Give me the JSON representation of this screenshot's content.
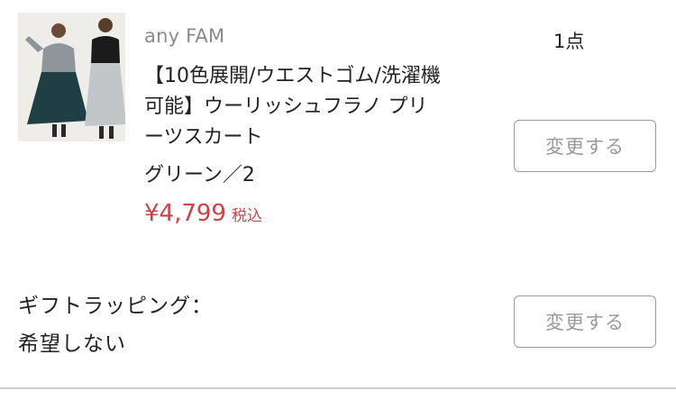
{
  "item": {
    "image_alt": "product-photo",
    "brand": "any FAM",
    "name": "【10色展開/ウエストゴム/洗濯機可能】ウーリッシュフラノ プリーツスカート",
    "variant": "グリーン／2",
    "price": "¥4,799",
    "tax_label": "税込",
    "quantity": "1点",
    "change_label": "変更する"
  },
  "gift": {
    "label": "ギフトラッピング：",
    "value": "希望しない",
    "change_label": "変更する"
  },
  "colors": {
    "price": "#c9424a",
    "button_border": "#9a9a9a",
    "divider": "#cfcfcf"
  }
}
